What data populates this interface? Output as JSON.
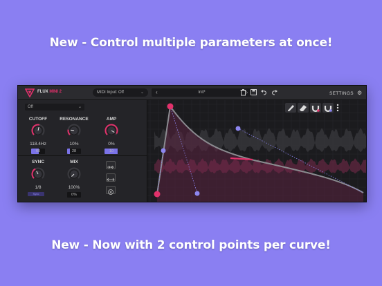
{
  "headline_top": "New - Control multiple parameters at once!",
  "headline_bottom": "New - Now with 2 control points per curve!",
  "plugin": {
    "brand_main": "FLUX",
    "brand_accent": "MINI 2",
    "midi_input": "MIDI Input: Off",
    "preset_name": "Init*",
    "settings_label": "SETTINGS",
    "mode": "Off",
    "knobs": [
      {
        "label": "CUTOFF",
        "value": "118.4Hz",
        "box": "68",
        "level": 0.55
      },
      {
        "label": "RESONANCE",
        "value": "10%",
        "box": "28",
        "level": 0.2
      },
      {
        "label": "AMP",
        "value": "0%",
        "box": "10",
        "level": 0.95
      },
      {
        "label": "SYNC",
        "value": "1/8",
        "box": "Sync",
        "level": 0.4
      },
      {
        "label": "MIX",
        "value": "100%",
        "box": "0%",
        "level": 0.0
      }
    ],
    "icons": [
      "flux-logo-icon",
      "chevron-down-icon",
      "arrow-left-icon",
      "arrow-right-icon",
      "trash-icon",
      "save-icon",
      "undo-icon",
      "redo-icon",
      "gear-icon",
      "pencil-icon",
      "eraser-icon",
      "magnet-icon",
      "more-icon"
    ],
    "accent_color": "#e2316b",
    "secondary_color": "#8d86f0"
  }
}
